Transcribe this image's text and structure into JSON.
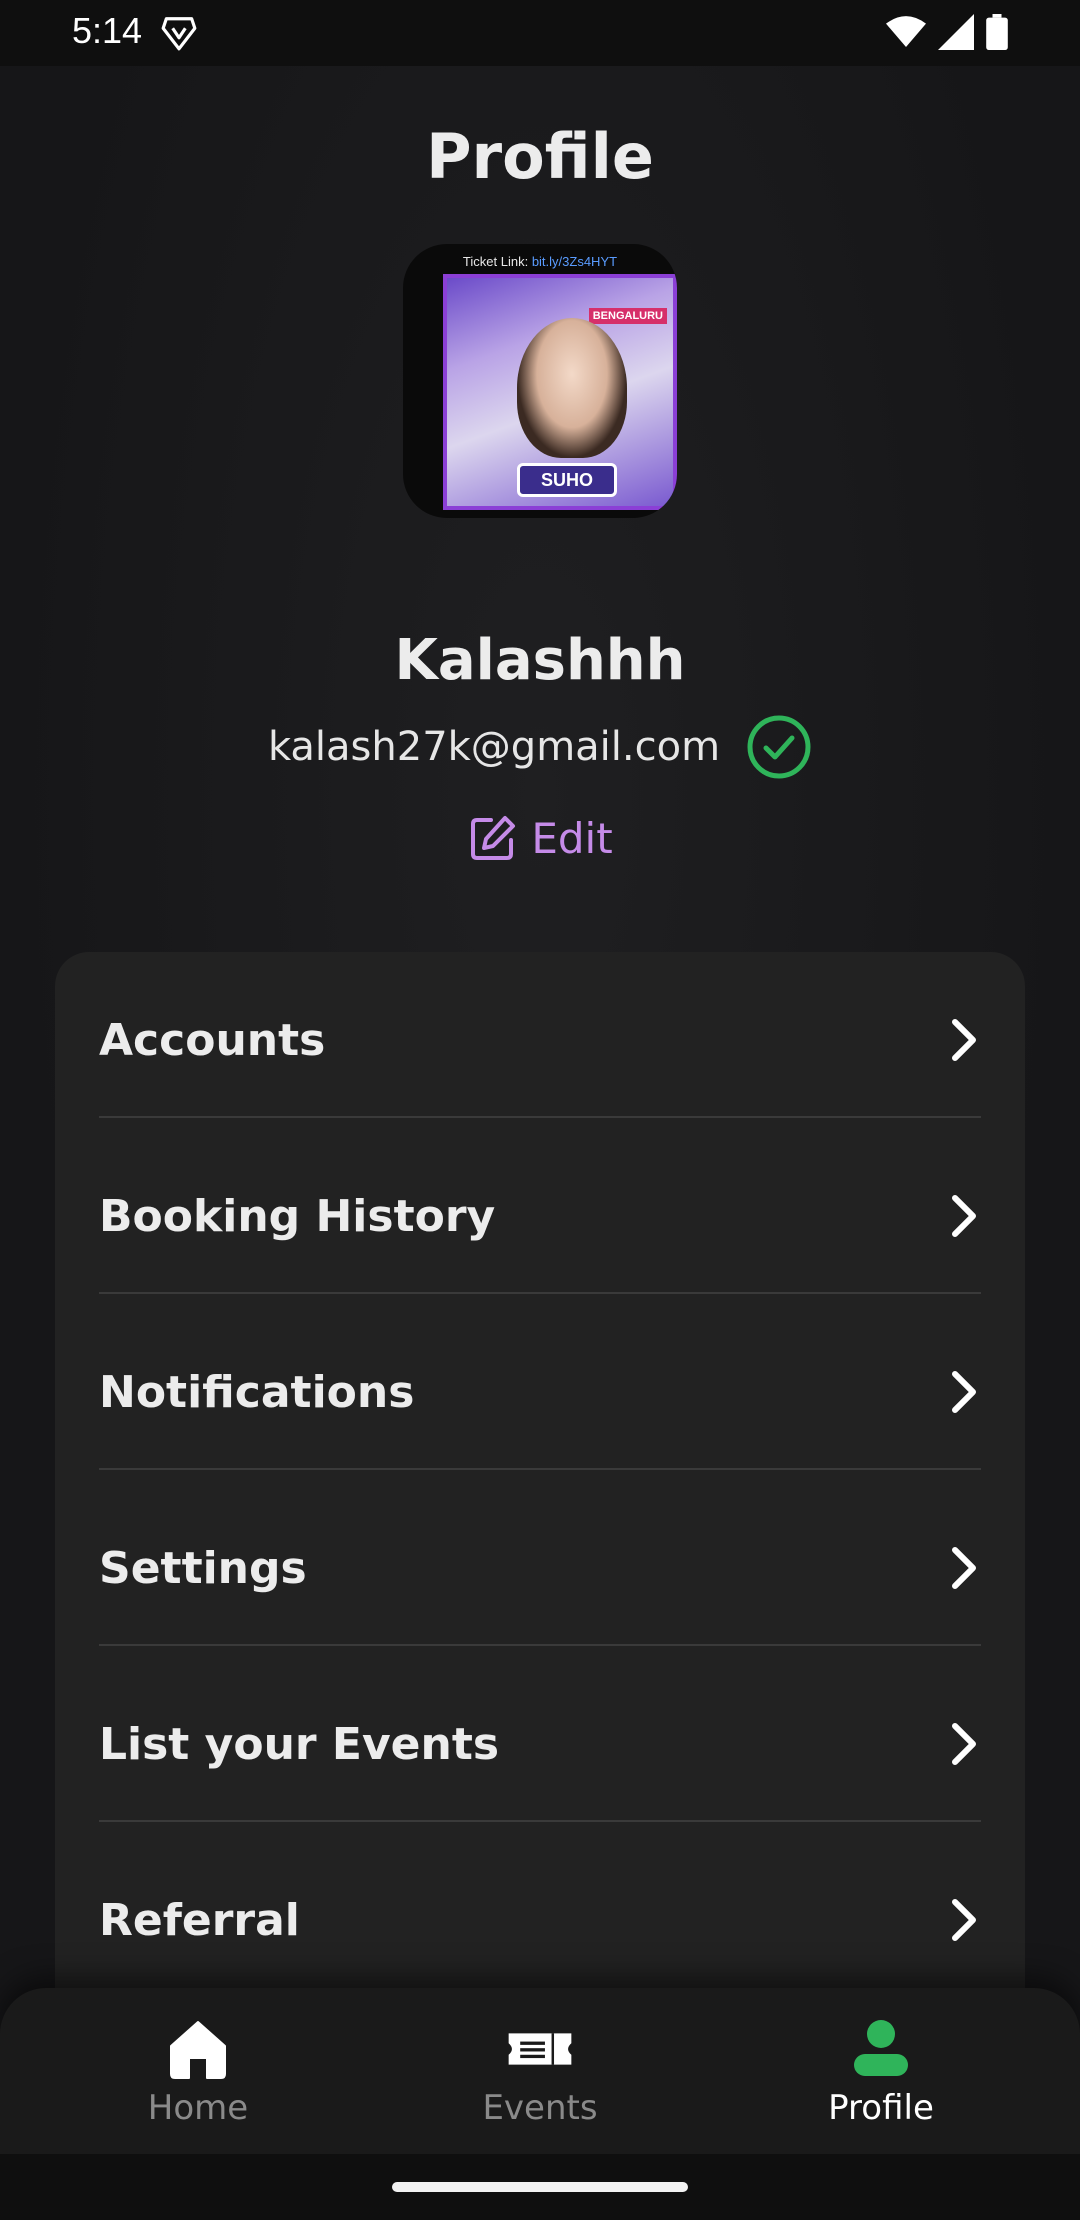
{
  "status_bar": {
    "time": "5:14",
    "icons": [
      "brave-icon",
      "wifi-icon",
      "signal-icon",
      "battery-icon"
    ]
  },
  "page": {
    "title": "Profile"
  },
  "avatar": {
    "ticket_label": "Ticket Link:",
    "ticket_link": "bit.ly/3Zs4HYT",
    "poster_tag": "SUHO",
    "poster_city": "BENGALURU"
  },
  "profile": {
    "name": "Kalashhh",
    "email": "kalash27k@gmail.com",
    "verified_icon": "check-circle-icon",
    "edit_label": "Edit"
  },
  "menu": {
    "items": [
      {
        "label": "Accounts"
      },
      {
        "label": "Booking History"
      },
      {
        "label": "Notifications"
      },
      {
        "label": "Settings"
      },
      {
        "label": "List your Events"
      },
      {
        "label": "Referral"
      }
    ]
  },
  "bottom_nav": {
    "items": [
      {
        "label": "Home",
        "icon": "home-icon",
        "active": false
      },
      {
        "label": "Events",
        "icon": "ticket-icon",
        "active": false
      },
      {
        "label": "Profile",
        "icon": "user-icon",
        "active": true
      }
    ]
  },
  "colors": {
    "background": "#171717",
    "card": "#222222",
    "accent_purple": "#c58be8",
    "verified_green": "#2fb45a",
    "inactive_nav": "#8a8a8a"
  }
}
